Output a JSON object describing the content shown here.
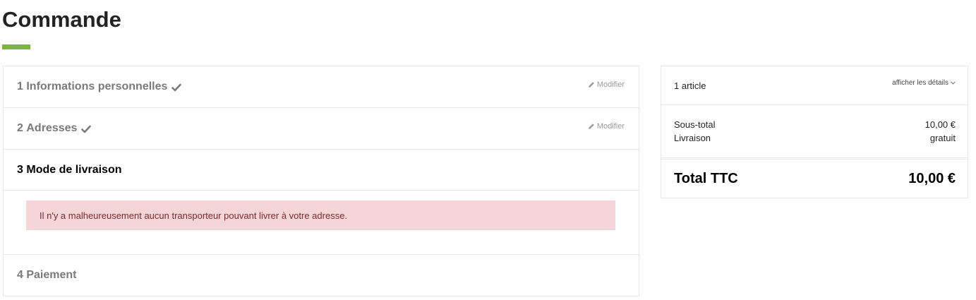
{
  "page": {
    "title": "Commande",
    "accent_color": "#7cb342"
  },
  "steps": [
    {
      "number": "1",
      "label": "Informations personnelles",
      "completed": true,
      "edit_label": "Modifier"
    },
    {
      "number": "2",
      "label": "Adresses",
      "completed": true,
      "edit_label": "Modifier"
    },
    {
      "number": "3",
      "label": "Mode de livraison",
      "current": true,
      "alert": "Il n'y a malheureusement aucun transporteur pouvant livrer à votre adresse."
    },
    {
      "number": "4",
      "label": "Paiement"
    }
  ],
  "summary": {
    "items_count": "1 article",
    "details_label": "afficher les détails",
    "subtotal_label": "Sous-total",
    "subtotal_value": "10,00 €",
    "shipping_label": "Livraison",
    "shipping_value": "gratuit",
    "total_label": "Total TTC",
    "total_value": "10,00 €"
  }
}
